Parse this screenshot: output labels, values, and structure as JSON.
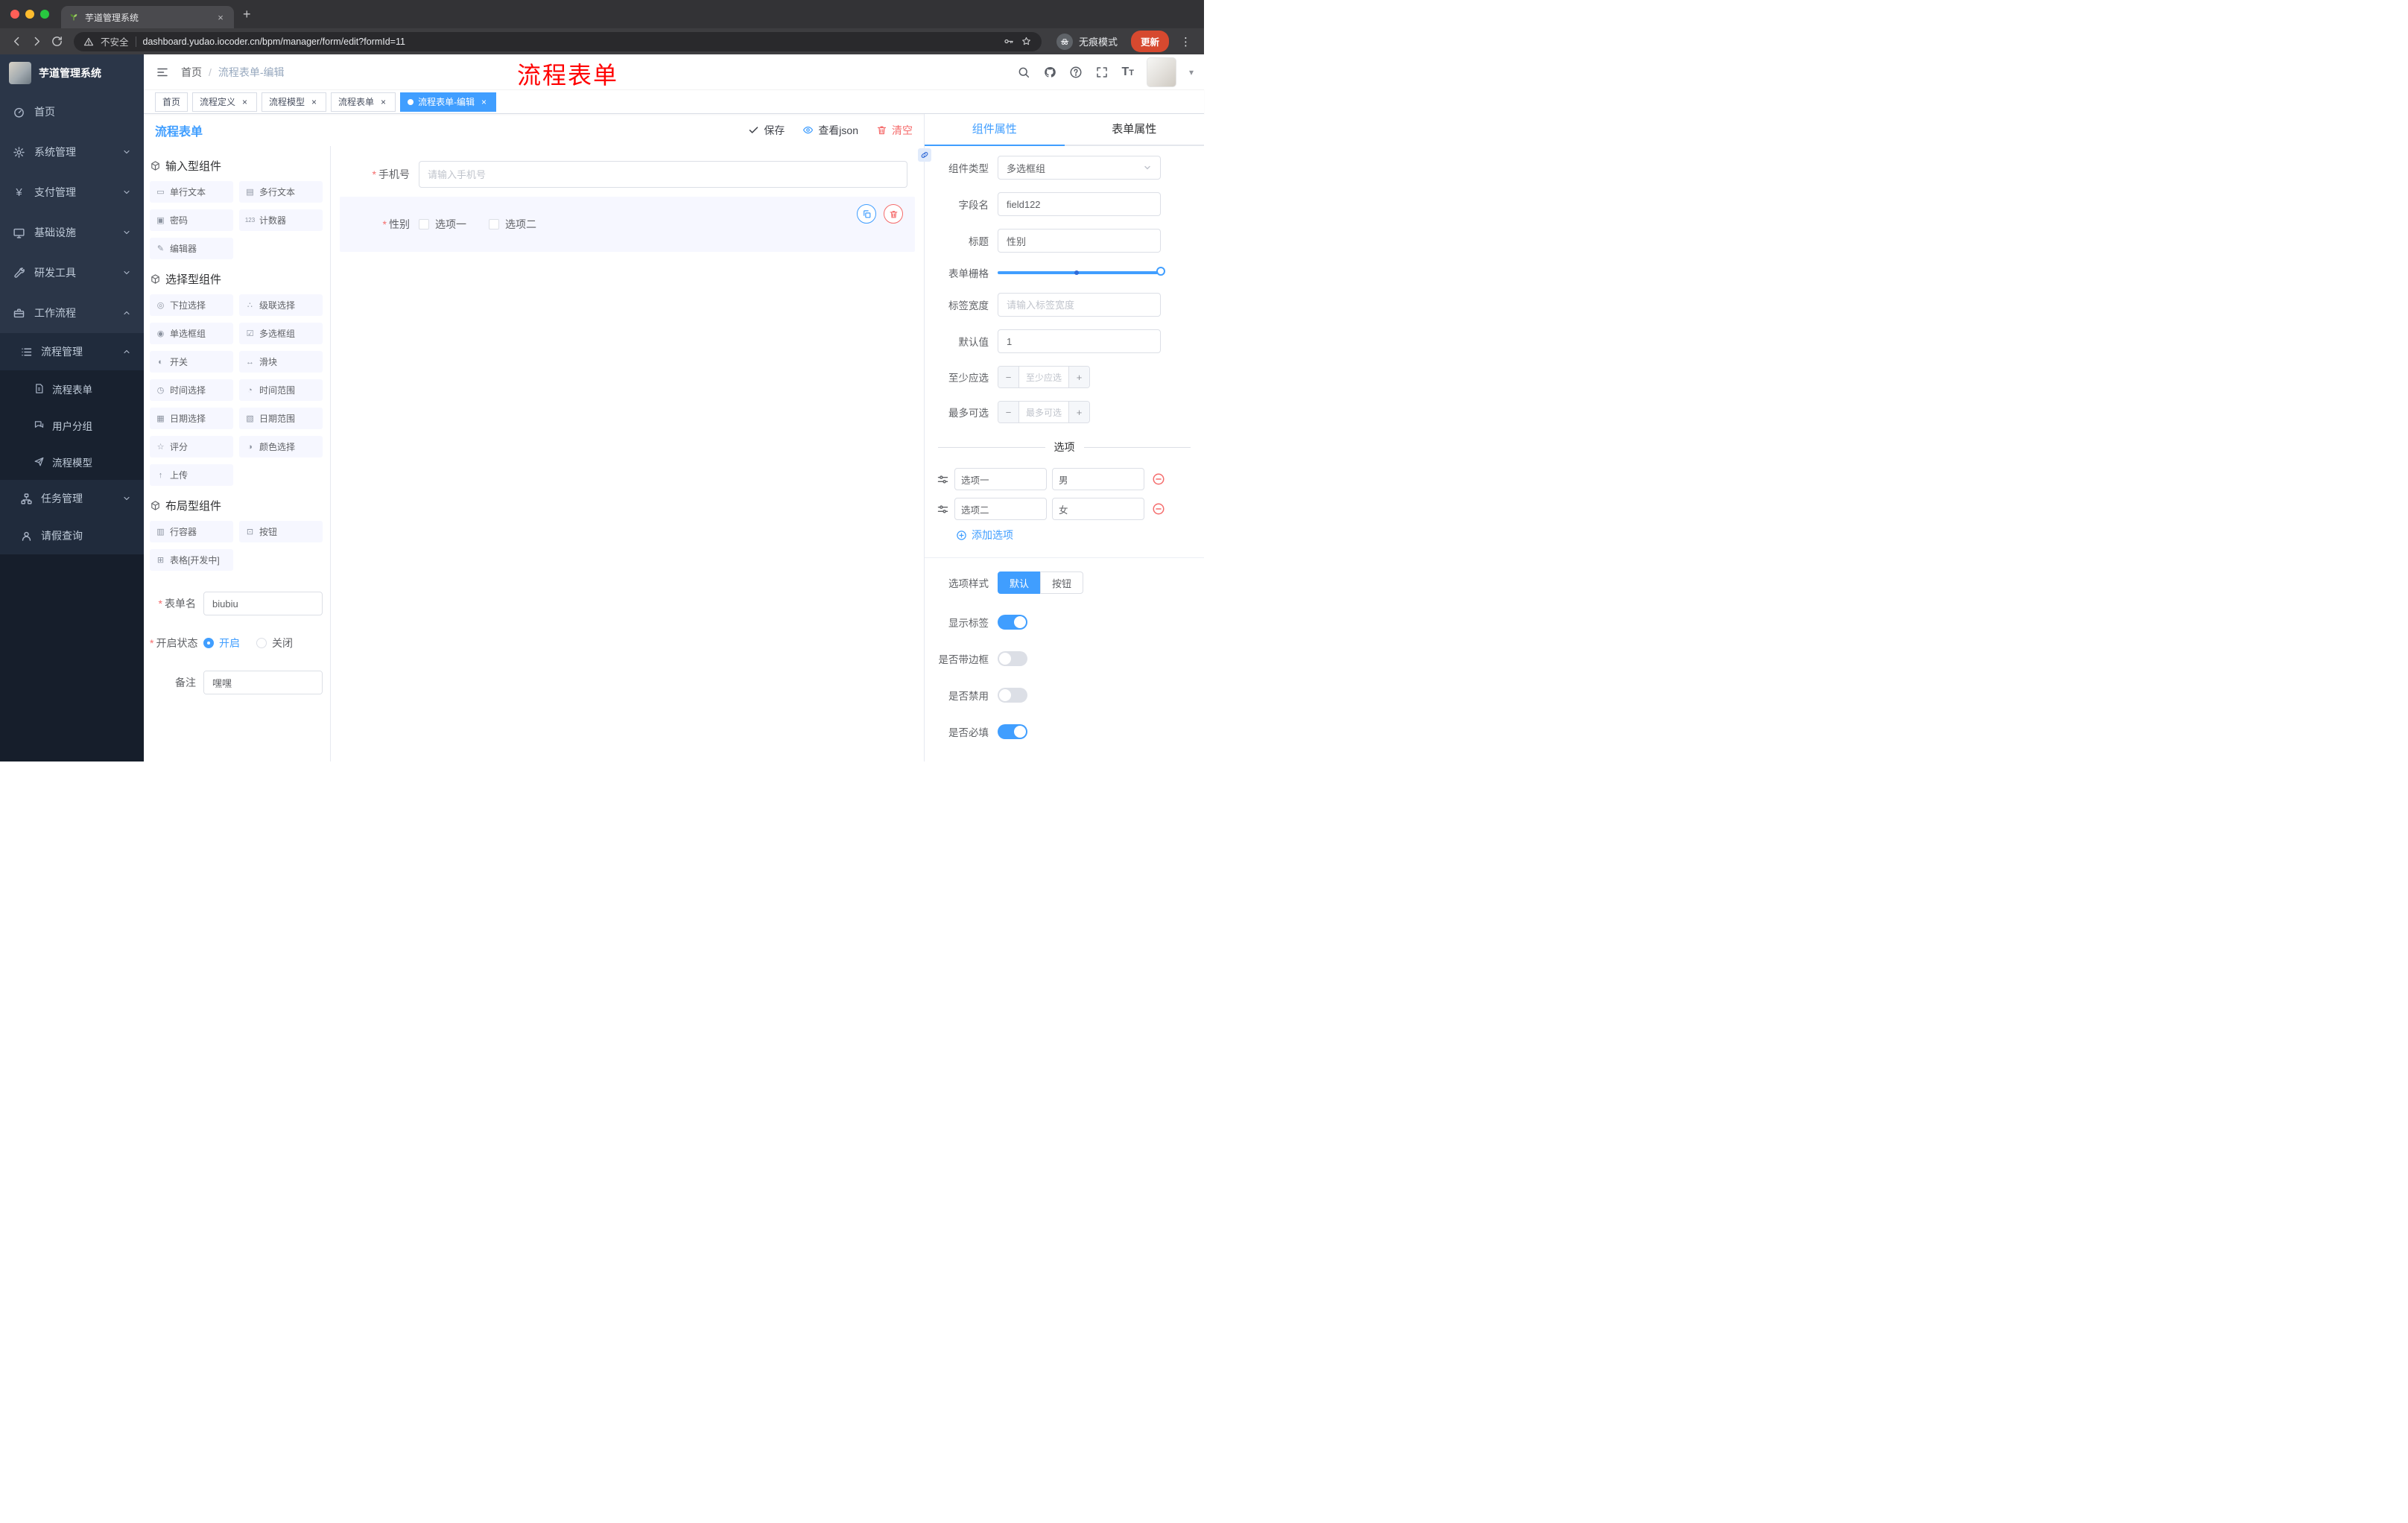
{
  "icons": {
    "close": "×",
    "new_tab": "+",
    "kebab": "⋮",
    "caret_down": "▾",
    "breadcrumb_sep": "/",
    "minus": "−",
    "plus": "+",
    "yen": "¥",
    "font": "T"
  },
  "ui": {
    "required": "*"
  },
  "browser": {
    "tab_title": "芋道管理系统",
    "security_label": "不安全",
    "url": "dashboard.yudao.iocoder.cn/bpm/manager/form/edit?formId=11",
    "incognito_label": "无痕模式",
    "update_label": "更新"
  },
  "sidebar": {
    "logo_title": "芋道管理系统",
    "items": [
      {
        "label": "首页",
        "icon": "dashboard-icon"
      },
      {
        "label": "系统管理",
        "icon": "gear-icon"
      },
      {
        "label": "支付管理",
        "icon": "yen-icon"
      },
      {
        "label": "基础设施",
        "icon": "monitor-icon"
      },
      {
        "label": "研发工具",
        "icon": "wrench-icon"
      },
      {
        "label": "工作流程",
        "icon": "briefcase-icon"
      }
    ],
    "process_group_label": "流程管理",
    "process_children": [
      {
        "label": "流程表单",
        "icon": "document-icon"
      },
      {
        "label": "用户分组",
        "icon": "chat-users-icon"
      },
      {
        "label": "流程模型",
        "icon": "send-icon"
      }
    ],
    "task_label": "任务管理",
    "leave_label": "请假查询"
  },
  "header": {
    "breadcrumb_home": "首页",
    "breadcrumb_current": "流程表单-编辑",
    "annotation": "流程表单"
  },
  "view_tabs": [
    {
      "label": "首页",
      "closable": false,
      "active": false
    },
    {
      "label": "流程定义",
      "closable": true,
      "active": false
    },
    {
      "label": "流程模型",
      "closable": true,
      "active": false
    },
    {
      "label": "流程表单",
      "closable": true,
      "active": false
    },
    {
      "label": "流程表单-编辑",
      "closable": true,
      "active": true
    }
  ],
  "designer": {
    "title": "流程表单",
    "toolbar": {
      "save": "保存",
      "view_json": "查看json",
      "clear": "清空"
    },
    "palette": {
      "groups": [
        {
          "title": "输入型组件",
          "items": [
            {
              "label": "单行文本",
              "icon": "single-line-text-icon",
              "glyph": "▭"
            },
            {
              "label": "多行文本",
              "icon": "multi-line-text-icon",
              "glyph": "▤"
            },
            {
              "label": "密码",
              "icon": "password-icon",
              "glyph": "▣"
            },
            {
              "label": "计数器",
              "icon": "counter-icon",
              "glyph": "123"
            },
            {
              "label": "编辑器",
              "icon": "editor-icon",
              "glyph": "✎"
            }
          ]
        },
        {
          "title": "选择型组件",
          "items": [
            {
              "label": "下拉选择",
              "icon": "select-icon",
              "glyph": "◎"
            },
            {
              "label": "级联选择",
              "icon": "cascader-icon",
              "glyph": "∴"
            },
            {
              "label": "单选框组",
              "icon": "radio-group-icon",
              "glyph": "◉"
            },
            {
              "label": "多选框组",
              "icon": "checkbox-group-icon",
              "glyph": "☑"
            },
            {
              "label": "开关",
              "icon": "switch-icon",
              "glyph": "◐"
            },
            {
              "label": "滑块",
              "icon": "slider-icon",
              "glyph": "↔"
            },
            {
              "label": "时间选择",
              "icon": "time-picker-icon",
              "glyph": "◷"
            },
            {
              "label": "时间范围",
              "icon": "time-range-icon",
              "glyph": "◔"
            },
            {
              "label": "日期选择",
              "icon": "date-picker-icon",
              "glyph": "▦"
            },
            {
              "label": "日期范围",
              "icon": "date-range-icon",
              "glyph": "▧"
            },
            {
              "label": "评分",
              "icon": "rate-icon",
              "glyph": "☆"
            },
            {
              "label": "颜色选择",
              "icon": "color-picker-icon",
              "glyph": "◑"
            },
            {
              "label": "上传",
              "icon": "upload-icon",
              "glyph": "↑"
            }
          ]
        },
        {
          "title": "布局型组件",
          "items": [
            {
              "label": "行容器",
              "icon": "row-container-icon",
              "glyph": "▥"
            },
            {
              "label": "按钮",
              "icon": "button-icon",
              "glyph": "⊡"
            },
            {
              "label": "表格[开发中]",
              "icon": "table-icon",
              "glyph": "⊞"
            }
          ]
        }
      ]
    },
    "meta": {
      "form_name_label": "表单名",
      "form_name_value": "biubiu",
      "status_label": "开启状态",
      "status_on": "开启",
      "status_off": "关闭",
      "remark_label": "备注",
      "remark_value": "嘿嘿"
    },
    "canvas": {
      "phone_label": "手机号",
      "phone_placeholder": "请输入手机号",
      "gender_label": "性别",
      "gender_options": [
        "选项一",
        "选项二"
      ]
    }
  },
  "properties": {
    "tab_component": "组件属性",
    "tab_form": "表单属性",
    "type_label": "组件类型",
    "type_value": "多选框组",
    "field_label": "字段名",
    "field_value": "field122",
    "title_label": "标题",
    "title_value": "性别",
    "grid_label": "表单栅格",
    "label_width_label": "标签宽度",
    "label_width_placeholder": "请输入标签宽度",
    "default_label": "默认值",
    "default_value": "1",
    "min_label": "至少应选",
    "min_placeholder": "至少应选",
    "max_label": "最多可选",
    "max_placeholder": "最多可选",
    "options_divider": "选项",
    "options": [
      {
        "name": "选项一",
        "value": "男"
      },
      {
        "name": "选项二",
        "value": "女"
      }
    ],
    "add_option_label": "添加选项",
    "style_label": "选项样式",
    "style_default": "默认",
    "style_button": "按钮",
    "switches": [
      {
        "label": "显示标签",
        "on": true
      },
      {
        "label": "是否带边框",
        "on": false
      },
      {
        "label": "是否禁用",
        "on": false
      },
      {
        "label": "是否必填",
        "on": true
      }
    ]
  }
}
